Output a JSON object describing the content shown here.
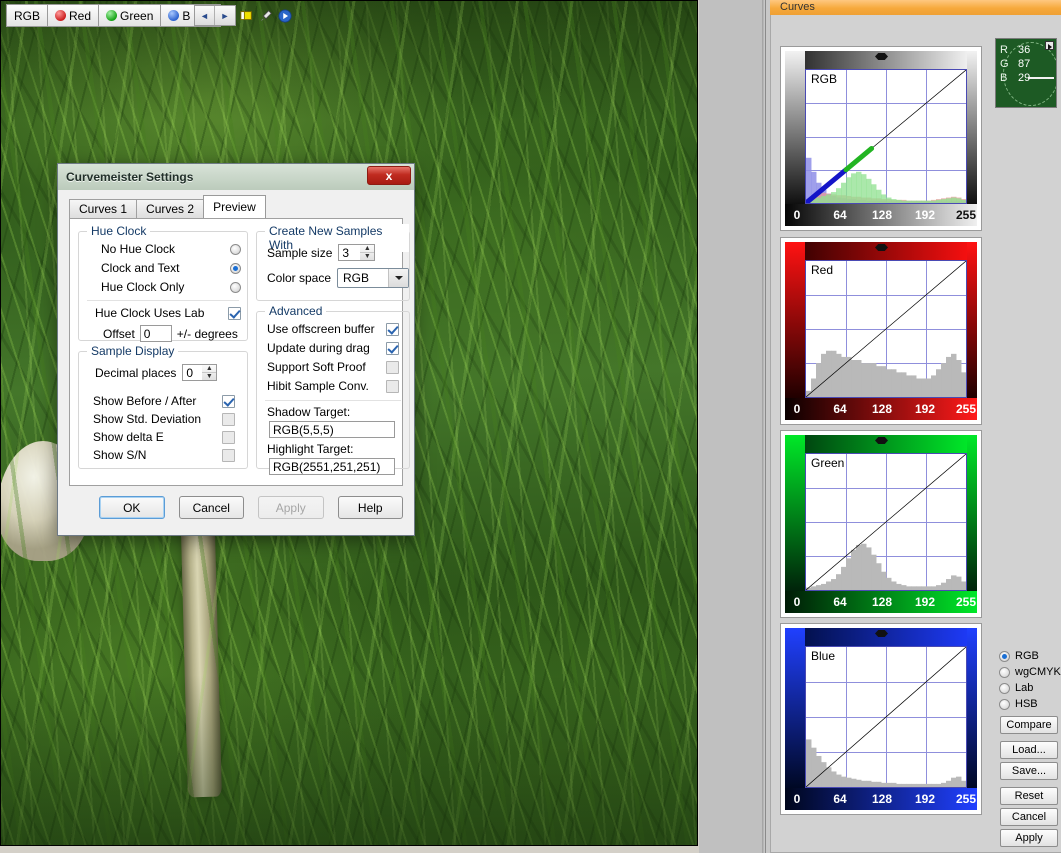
{
  "photo": {
    "alt": "mushroom-in-grass-photo"
  },
  "curves_panel": {
    "title": "Curves",
    "channel_tabs": [
      {
        "label": "RGB",
        "icon": "none"
      },
      {
        "label": "Red",
        "icon": "red-channel-icon"
      },
      {
        "label": "Green",
        "icon": "green-channel-icon"
      },
      {
        "label": "B",
        "icon": "blue-channel-icon"
      }
    ],
    "scroll_left": "◄",
    "scroll_right": "►",
    "tools": [
      "note-icon",
      "eyedropper-icon",
      "play-icon"
    ],
    "hue_clock": {
      "labels": [
        "R",
        "G",
        "B"
      ],
      "values": [
        "36",
        "87",
        "29"
      ],
      "background": "#1d5a24"
    },
    "mode_options": [
      {
        "label": "RGB",
        "selected": true
      },
      {
        "label": "wgCMYK",
        "selected": false
      },
      {
        "label": "Lab",
        "selected": false
      },
      {
        "label": "HSB",
        "selected": false
      }
    ],
    "buttons": [
      "Compare",
      "Load...",
      "Save...",
      "Reset",
      "Cancel",
      "Apply"
    ]
  },
  "chart_data": [
    {
      "type": "line",
      "title": "RGB",
      "xlabel": "",
      "ylabel": "",
      "xlim": [
        0,
        255
      ],
      "ylim": [
        0,
        255
      ],
      "ticks": [
        0,
        64,
        128,
        192,
        255
      ],
      "grid": true,
      "series": [
        {
          "name": "curve",
          "x": [
            0,
            255
          ],
          "y": [
            0,
            255
          ]
        },
        {
          "name": "blue-segment",
          "x": [
            0,
            64
          ],
          "y": [
            0,
            64
          ],
          "color": "#1414c8"
        },
        {
          "name": "green-segment",
          "x": [
            64,
            104
          ],
          "y": [
            64,
            104
          ],
          "color": "#22b422"
        }
      ],
      "histogram": {
        "blue": [
          58,
          40,
          26,
          17,
          12,
          9,
          7,
          6,
          5,
          5,
          4,
          4,
          3,
          3,
          3,
          3,
          2,
          2,
          2,
          2,
          2,
          2,
          2,
          2,
          2,
          2,
          2,
          2,
          2,
          2,
          2,
          2
        ],
        "red": [
          4,
          7,
          11,
          13,
          12,
          11,
          10,
          10,
          9,
          8,
          8,
          7,
          7,
          6,
          6,
          5,
          5,
          4,
          4,
          4,
          3,
          3,
          3,
          3,
          3,
          4,
          5,
          6,
          7,
          8,
          7,
          5
        ],
        "green": [
          3,
          5,
          7,
          9,
          11,
          14,
          19,
          26,
          33,
          38,
          40,
          37,
          31,
          24,
          17,
          11,
          7,
          5,
          4,
          3,
          3,
          3,
          3,
          3,
          3,
          3,
          4,
          5,
          6,
          7,
          6,
          4
        ]
      }
    },
    {
      "type": "line",
      "title": "Red",
      "xlim": [
        0,
        255
      ],
      "ylim": [
        0,
        255
      ],
      "ticks": [
        0,
        64,
        128,
        192,
        255
      ],
      "grid": true,
      "series": [
        {
          "name": "curve",
          "x": [
            0,
            255
          ],
          "y": [
            0,
            255
          ]
        }
      ],
      "histogram": {
        "gray": [
          2,
          6,
          11,
          14,
          15,
          15,
          14,
          13,
          13,
          12,
          12,
          11,
          11,
          11,
          10,
          10,
          9,
          9,
          8,
          8,
          7,
          7,
          6,
          6,
          6,
          7,
          9,
          11,
          13,
          14,
          12,
          8
        ]
      }
    },
    {
      "type": "line",
      "title": "Green",
      "xlim": [
        0,
        255
      ],
      "ylim": [
        0,
        255
      ],
      "ticks": [
        0,
        64,
        128,
        192,
        255
      ],
      "grid": true,
      "series": [
        {
          "name": "curve",
          "x": [
            0,
            255
          ],
          "y": [
            0,
            255
          ]
        }
      ],
      "histogram": {
        "gray": [
          2,
          3,
          4,
          5,
          7,
          9,
          13,
          19,
          26,
          33,
          37,
          38,
          35,
          29,
          22,
          15,
          10,
          7,
          5,
          4,
          3,
          3,
          3,
          3,
          3,
          3,
          4,
          6,
          9,
          12,
          11,
          7
        ]
      }
    },
    {
      "type": "line",
      "title": "Blue",
      "xlim": [
        0,
        255
      ],
      "ylim": [
        0,
        255
      ],
      "ticks": [
        0,
        64,
        128,
        192,
        255
      ],
      "grid": true,
      "series": [
        {
          "name": "curve",
          "x": [
            0,
            255
          ],
          "y": [
            0,
            255
          ]
        }
      ],
      "histogram": {
        "gray": [
          46,
          38,
          30,
          24,
          19,
          15,
          12,
          10,
          9,
          8,
          7,
          6,
          6,
          5,
          5,
          4,
          4,
          4,
          3,
          3,
          3,
          3,
          3,
          3,
          3,
          3,
          3,
          4,
          6,
          9,
          10,
          6
        ]
      }
    }
  ],
  "dialog": {
    "title": "Curvemeister Settings",
    "close_label": "x",
    "tabs": [
      {
        "label": "Curves 1",
        "active": false
      },
      {
        "label": "Curves 2",
        "active": false
      },
      {
        "label": "Preview",
        "active": true
      }
    ],
    "hue_clock_group": {
      "legend": "Hue Clock",
      "options": [
        {
          "label": "No Hue Clock",
          "selected": false
        },
        {
          "label": "Clock and Text",
          "selected": true
        },
        {
          "label": "Hue Clock Only",
          "selected": false
        }
      ],
      "uses_lab": {
        "label": "Hue Clock Uses Lab",
        "checked": true
      },
      "offset": {
        "label": "Offset",
        "value": "0",
        "suffix": "+/- degrees"
      }
    },
    "sample_display_group": {
      "legend": "Sample Display",
      "decimal_places": {
        "label": "Decimal places",
        "value": "0"
      },
      "checks": [
        {
          "label": "Show Before / After",
          "checked": true
        },
        {
          "label": "Show Std. Deviation",
          "checked": false
        },
        {
          "label": "Show delta E",
          "checked": false
        },
        {
          "label": "Show S/N",
          "checked": false
        }
      ]
    },
    "create_samples_group": {
      "legend": "Create New Samples With",
      "sample_size": {
        "label": "Sample size",
        "value": "3"
      },
      "color_space": {
        "label": "Color space",
        "value": "RGB"
      }
    },
    "advanced_group": {
      "legend": "Advanced",
      "checks": [
        {
          "label": "Use offscreen buffer",
          "checked": true
        },
        {
          "label": "Update during drag",
          "checked": true
        },
        {
          "label": "Support Soft Proof",
          "checked": false
        },
        {
          "label": "Hibit Sample Conv.",
          "checked": false
        }
      ],
      "shadow_target": {
        "label": "Shadow Target:",
        "value": "RGB(5,5,5)"
      },
      "highlight_target": {
        "label": "Highlight Target:",
        "value": "RGB(2551,251,251)"
      }
    },
    "buttons": [
      {
        "label": "OK",
        "state": "default"
      },
      {
        "label": "Cancel",
        "state": "normal"
      },
      {
        "label": "Apply",
        "state": "disabled"
      },
      {
        "label": "Help",
        "state": "normal"
      }
    ]
  }
}
